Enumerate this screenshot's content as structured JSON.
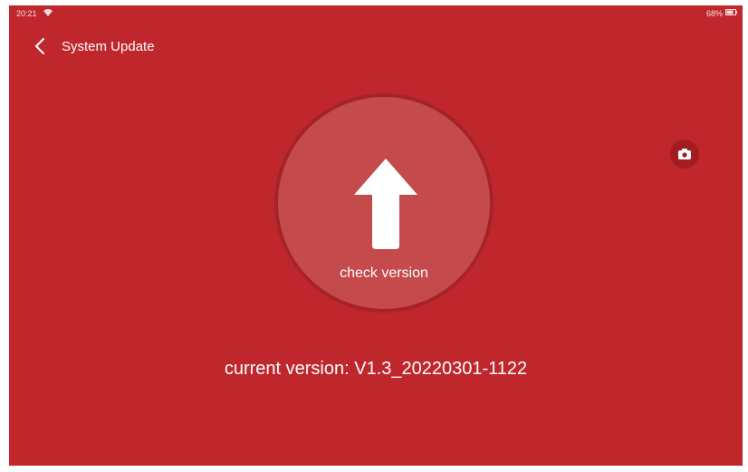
{
  "status_bar": {
    "time": "20:21",
    "battery": "68%",
    "icons": [
      "wifi-icon",
      "battery-icon"
    ]
  },
  "header": {
    "title": "System Update",
    "back_icon": "chevron-left-icon"
  },
  "main": {
    "check_label": "check version",
    "upload_icon": "arrow-up-icon",
    "camera_icon": "camera-icon",
    "current_version": "current version: V1.3_20220301-1122"
  },
  "colors": {
    "background": "#c0272d",
    "circle": "#c44a4c",
    "text": "#ffffff"
  }
}
